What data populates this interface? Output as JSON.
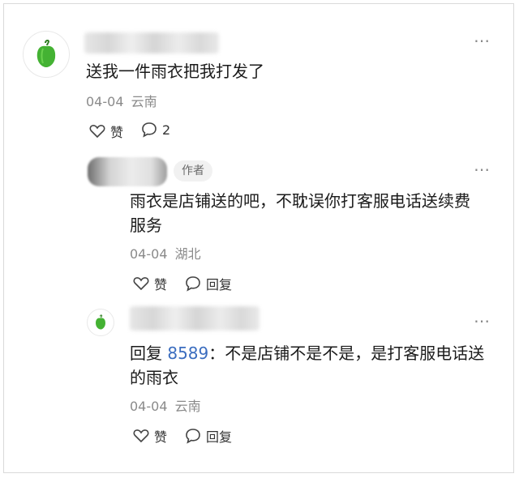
{
  "comments": [
    {
      "avatar": "green-pepper-icon",
      "text": "送我一件雨衣把我打发了",
      "date": "04-04",
      "location": "云南",
      "actions": {
        "like_label": "赞",
        "reply_count": "2"
      }
    }
  ],
  "replies": [
    {
      "badge": "作者",
      "text_line1": "雨衣是店铺送的吧，不耽误你打客服电话送续费",
      "text_line2": "服务",
      "date": "04-04",
      "location": "湖北",
      "actions": {
        "like_label": "赞",
        "reply_label": "回复"
      }
    },
    {
      "avatar": "green-pepper-icon",
      "prefix": "回复",
      "reply_to": "8589",
      "text_line1_rest": "：不是店铺不是不是，是打客服电话送",
      "text_line2": "的雨衣",
      "date": "04-04",
      "location": "云南",
      "actions": {
        "like_label": "赞",
        "reply_label": "回复"
      }
    }
  ],
  "colors": {
    "pepper_green": "#44b233",
    "meta_gray": "#8a8a8a",
    "accent_blue": "#3b6dbf"
  }
}
